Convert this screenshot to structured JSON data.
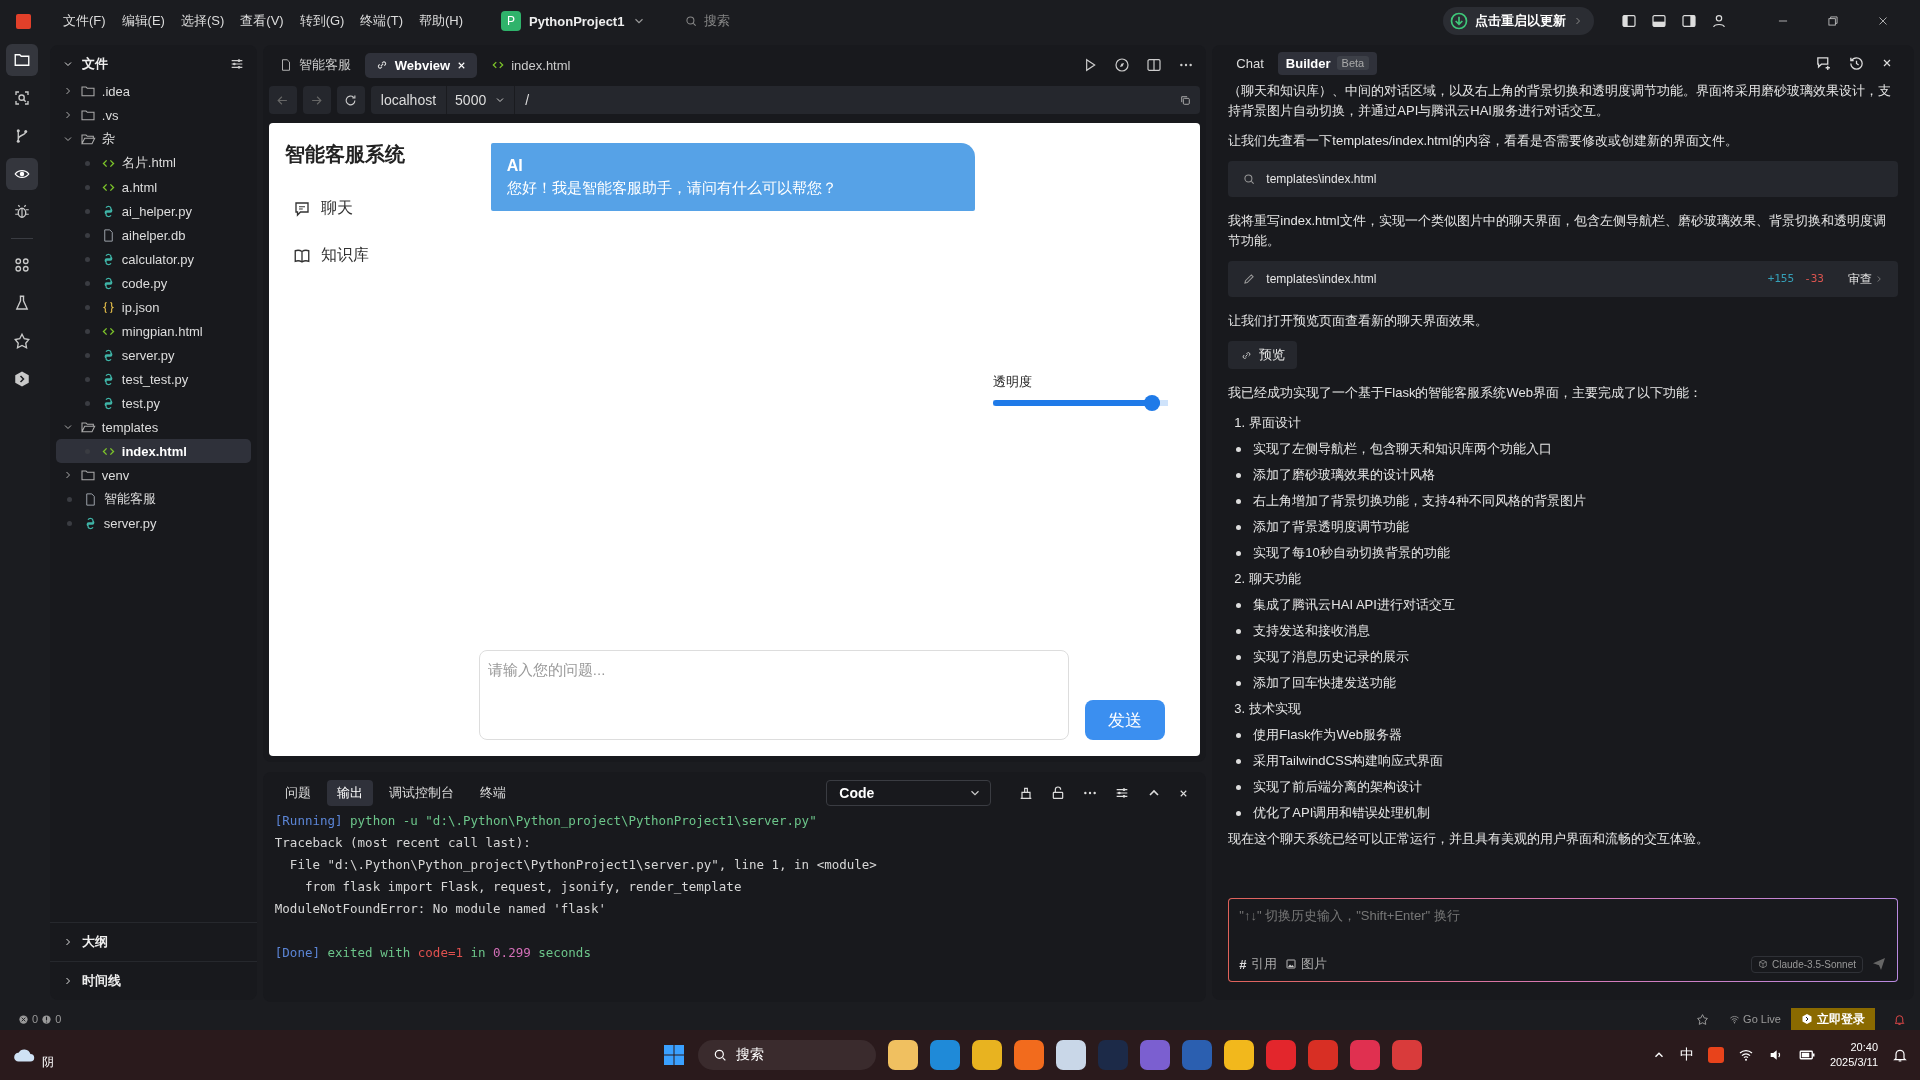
{
  "titlebar": {
    "menu": [
      "文件(F)",
      "编辑(E)",
      "选择(S)",
      "查看(V)",
      "转到(G)",
      "终端(T)",
      "帮助(H)"
    ],
    "project": {
      "badge": "P",
      "name": "PythonProject1"
    },
    "search": {
      "placeholder": "搜索"
    },
    "update_button": "点击重启以更新"
  },
  "activity_bar": [
    {
      "selected": true
    },
    {
      "selected": false
    },
    {
      "selected": false
    },
    {
      "selected": true
    },
    {
      "selected": false
    },
    {
      "selected": false
    },
    {
      "selected": false
    },
    {
      "selected": false
    },
    {
      "selected": false
    }
  ],
  "explorer": {
    "title": "文件",
    "tree": [
      {
        "name": ".idea",
        "kind": "folder",
        "expanded": false,
        "selected": false
      },
      {
        "name": ".vs",
        "kind": "folder",
        "expanded": false,
        "selected": false
      },
      {
        "name": "杂",
        "kind": "folder",
        "expanded": true,
        "selected": false,
        "children": [
          {
            "name": "名片.html",
            "kind": "html",
            "selected": false
          },
          {
            "name": "a.html",
            "kind": "html",
            "selected": false
          },
          {
            "name": "ai_helper.py",
            "kind": "py",
            "selected": false
          },
          {
            "name": "aihelper.db",
            "kind": "file",
            "selected": false
          },
          {
            "name": "calculator.py",
            "kind": "py",
            "selected": false
          },
          {
            "name": "code.py",
            "kind": "py",
            "selected": false
          },
          {
            "name": "ip.json",
            "kind": "json",
            "selected": false
          },
          {
            "name": "mingpian.html",
            "kind": "html",
            "selected": false
          },
          {
            "name": "server.py",
            "kind": "py",
            "selected": false
          },
          {
            "name": "test_test.py",
            "kind": "py",
            "selected": false
          },
          {
            "name": "test.py",
            "kind": "py",
            "selected": false
          }
        ]
      },
      {
        "name": "templates",
        "kind": "folder",
        "expanded": true,
        "selected": false,
        "children": [
          {
            "name": "index.html",
            "kind": "html",
            "selected": true
          }
        ]
      },
      {
        "name": "venv",
        "kind": "folder",
        "expanded": false,
        "selected": false
      },
      {
        "name": "智能客服",
        "kind": "file",
        "selected": false
      },
      {
        "name": "server.py",
        "kind": "py",
        "selected": false
      }
    ],
    "sections": [
      {
        "title": "大纲",
        "expanded": false
      },
      {
        "title": "时间线",
        "expanded": false
      }
    ]
  },
  "editor": {
    "tabs": [
      {
        "label": "智能客服",
        "kind": "file",
        "selected": false
      },
      {
        "label": "Webview",
        "kind": "link",
        "selected": true
      },
      {
        "label": "index.html",
        "kind": "html",
        "selected": false
      }
    ],
    "address": {
      "host": "localhost",
      "port": "5000",
      "path": "/"
    },
    "webview": {
      "title": "智能客服系统",
      "nav": [
        {
          "label": "聊天"
        },
        {
          "label": "知识库"
        }
      ],
      "message": {
        "sender": "AI",
        "text": "您好！我是智能客服助手，请问有什么可以帮您？"
      },
      "opacity": {
        "label": "透明度",
        "level": 0.95
      },
      "input": {
        "placeholder": "请输入您的问题..."
      },
      "send": "发送"
    }
  },
  "panel": {
    "tabs": [
      {
        "label": "问题",
        "selected": false
      },
      {
        "label": "输出",
        "selected": true
      },
      {
        "label": "调试控制台",
        "selected": false
      },
      {
        "label": "终端",
        "selected": false
      }
    ],
    "channel": "Code",
    "lines": [
      {
        "kind": "text",
        "segments": [
          {
            "kind": "tag",
            "text": "[Running]"
          },
          {
            "kind": "cmd",
            "text": " python -u \"d:\\.Python\\Python_project\\PythonProject1\\server.py\""
          }
        ]
      },
      {
        "kind": "text",
        "segments": [
          {
            "kind": "plain",
            "text": "Traceback (most recent call last):"
          }
        ]
      },
      {
        "kind": "text",
        "segments": [
          {
            "kind": "plain",
            "text": "  File \"d:\\.Python\\Python_project\\PythonProject1\\server.py\", line 1, in <module>"
          }
        ]
      },
      {
        "kind": "text",
        "segments": [
          {
            "kind": "plain",
            "text": "    from flask import Flask, request, jsonify, render_template"
          }
        ]
      },
      {
        "kind": "text",
        "segments": [
          {
            "kind": "plain",
            "text": "ModuleNotFoundError: No module named 'flask'"
          }
        ]
      },
      {
        "kind": "blank"
      },
      {
        "kind": "text",
        "segments": [
          {
            "kind": "tag",
            "text": "[Done]"
          },
          {
            "kind": "cmd",
            "text": " exited with "
          },
          {
            "kind": "err",
            "text": "code=1"
          },
          {
            "kind": "cmd",
            "text": " in "
          },
          {
            "kind": "num",
            "text": "0.299"
          },
          {
            "kind": "cmd",
            "text": " seconds"
          }
        ]
      }
    ]
  },
  "assistant": {
    "tabs": [
      {
        "label": "Chat",
        "selected": false
      },
      {
        "label": "Builder",
        "badge": "Beta",
        "selected": true
      }
    ],
    "blocks": [
      {
        "kind": "para",
        "text": "（聊天和知识库）、中间的对话区域，以及右上角的背景切换和透明度调节功能。界面将采用磨砂玻璃效果设计，支持背景图片自动切换，并通过API与腾讯云HAI服务进行对话交互。"
      },
      {
        "kind": "para",
        "text": "让我们先查看一下templates/index.html的内容，看看是否需要修改或创建新的界面文件。"
      },
      {
        "kind": "file",
        "path": "templates\\index.html"
      },
      {
        "kind": "para",
        "text": "我将重写index.html文件，实现一个类似图片中的聊天界面，包含左侧导航栏、磨砂玻璃效果、背景切换和透明度调节功能。"
      },
      {
        "kind": "file",
        "path": "templates\\index.html",
        "added": "+155",
        "removed": "-33",
        "action": "审查"
      },
      {
        "kind": "para",
        "text": "让我们打开预览页面查看新的聊天界面效果。"
      },
      {
        "kind": "button",
        "text": "预览"
      },
      {
        "kind": "para",
        "text": "我已经成功实现了一个基于Flask的智能客服系统Web界面，主要完成了以下功能："
      },
      {
        "kind": "numbered",
        "text": "1. 界面设计"
      },
      {
        "kind": "bullet",
        "text": "实现了左侧导航栏，包含聊天和知识库两个功能入口"
      },
      {
        "kind": "bullet",
        "text": "添加了磨砂玻璃效果的设计风格"
      },
      {
        "kind": "bullet",
        "text": "右上角增加了背景切换功能，支持4种不同风格的背景图片"
      },
      {
        "kind": "bullet",
        "text": "添加了背景透明度调节功能"
      },
      {
        "kind": "bullet",
        "text": "实现了每10秒自动切换背景的功能"
      },
      {
        "kind": "numbered",
        "text": "2. 聊天功能"
      },
      {
        "kind": "bullet",
        "text": "集成了腾讯云HAI API进行对话交互"
      },
      {
        "kind": "bullet",
        "text": "支持发送和接收消息"
      },
      {
        "kind": "bullet",
        "text": "实现了消息历史记录的展示"
      },
      {
        "kind": "bullet",
        "text": "添加了回车快捷发送功能"
      },
      {
        "kind": "numbered",
        "text": "3. 技术实现"
      },
      {
        "kind": "bullet",
        "text": "使用Flask作为Web服务器"
      },
      {
        "kind": "bullet",
        "text": "采用TailwindCSS构建响应式界面"
      },
      {
        "kind": "bullet",
        "text": "实现了前后端分离的架构设计"
      },
      {
        "kind": "bullet",
        "text": "优化了API调用和错误处理机制"
      },
      {
        "kind": "para",
        "text": "现在这个聊天系统已经可以正常运行，并且具有美观的用户界面和流畅的交互体验。"
      }
    ],
    "composer": {
      "placeholder": "\"↑↓\" 切换历史输入，\"Shift+Enter\" 换行",
      "hash": "#",
      "reference": "引用",
      "image": "图片",
      "model": "Claude-3.5-Sonnet"
    }
  },
  "status_bar": {
    "errors": "0",
    "warnings": "0",
    "go_live": "Go Live",
    "login": "立即登录"
  },
  "taskbar": {
    "weather": "阴",
    "search": "搜索",
    "ime": "中",
    "time": "20:40",
    "date": "2025/3/11"
  }
}
